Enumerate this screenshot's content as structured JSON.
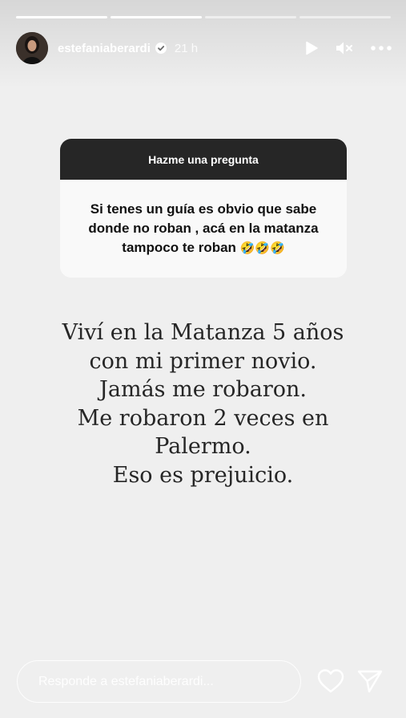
{
  "story": {
    "progress": [
      1.0,
      1.0,
      0.0,
      0.0
    ],
    "username": "estefaniaberardi",
    "time": "21 h"
  },
  "question": {
    "header": "Hazme una pregunta",
    "body_lines": [
      "Si tenes un guía es obvio que sabe",
      "donde no roban , acá en la matanza",
      "tampoco te roban"
    ],
    "emojis": "🤣🤣🤣"
  },
  "caption": [
    "Viví en la Matanza 5 años",
    "con mi primer novio.",
    "Jamás me robaron.",
    "Me robaron 2 veces en",
    "Palermo.",
    "Eso es prejuicio."
  ],
  "footer": {
    "reply_placeholder": "Responde a estefaniaberardi..."
  },
  "icons": {
    "play": "play-icon",
    "mute": "mute-icon",
    "more": "more-icon",
    "verified": "verified-badge-icon",
    "like": "heart-icon",
    "send": "send-icon"
  },
  "colors": {
    "background": "#efefef",
    "question_header": "#262626",
    "text": "#262626"
  }
}
